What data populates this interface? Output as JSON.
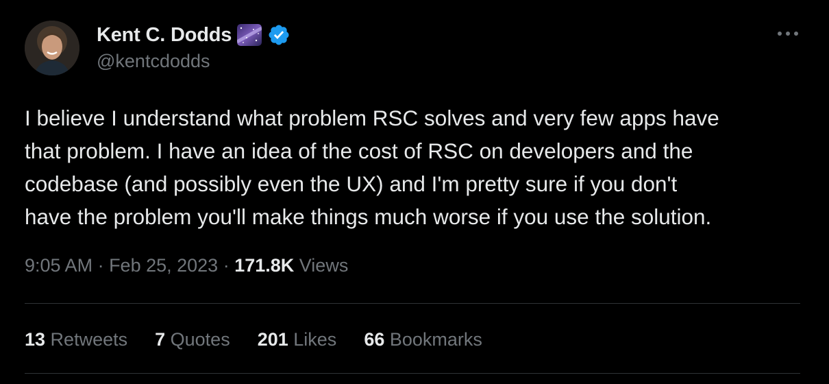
{
  "author": {
    "display_name": "Kent C. Dodds",
    "handle": "@kentcdodds",
    "badge_icon": "milky-way-emoji",
    "verified_icon": "verified-badge-icon",
    "verified_color": "#1d9bf0"
  },
  "tweet": {
    "text": "I believe I understand what problem RSC solves and very few apps have\nthat problem. I have an idea of the cost of RSC on developers and the\ncodebase (and possibly even the UX) and I'm pretty sure if you don't\nhave the problem you'll make things much worse if you use the solution."
  },
  "meta": {
    "time": "9:05 AM",
    "separator": " · ",
    "date": "Feb 25, 2023",
    "separator2": " · ",
    "views_count": "171.8K",
    "views_label": " Views"
  },
  "stats": {
    "retweets": {
      "count": "13",
      "label": " Retweets"
    },
    "quotes": {
      "count": "7",
      "label": " Quotes"
    },
    "likes": {
      "count": "201",
      "label": " Likes"
    },
    "bookmarks": {
      "count": "66",
      "label": " Bookmarks"
    }
  },
  "more_icon": "more-horizontal-icon",
  "colors": {
    "background": "#000000",
    "text_primary": "#e7e9ea",
    "text_secondary": "#71767b",
    "divider": "#2f3336",
    "accent": "#1d9bf0"
  }
}
